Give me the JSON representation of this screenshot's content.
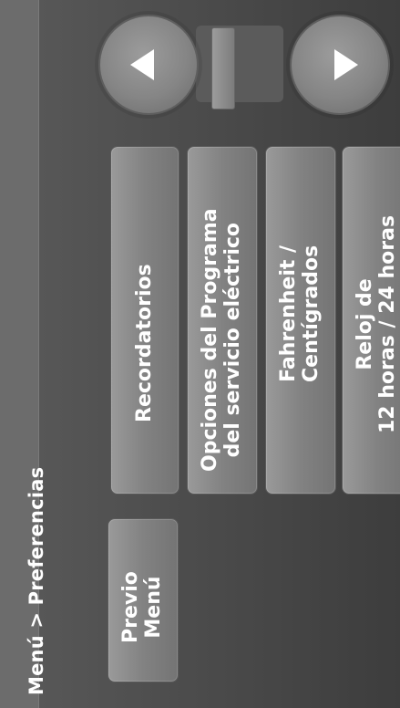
{
  "header": {
    "breadcrumb": "Menú > Preferencias"
  },
  "buttons": {
    "previo": {
      "line1": "Previo",
      "line2": "Menú"
    },
    "recordatorios": {
      "line1": "Recordatorios"
    },
    "opciones": {
      "line1": "Opciones del Programa",
      "line2": "del servicio eléctrico"
    },
    "fahrenheit": {
      "line1": "Fahrenheit /",
      "line2": "Centígrados"
    },
    "reloj": {
      "line1": "Reloj de",
      "line2": "12 horas / 24 horas"
    }
  },
  "nav": {
    "up_icon": "arrow-left-icon",
    "down_icon": "arrow-right-icon"
  },
  "colors": {
    "background": "#4e4e4e",
    "button": "#8a8a8a",
    "text": "#ffffff"
  }
}
